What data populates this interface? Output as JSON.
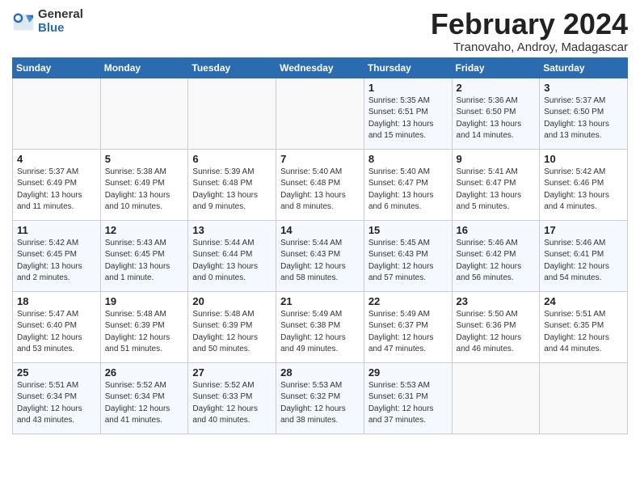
{
  "logo": {
    "general": "General",
    "blue": "Blue"
  },
  "title": "February 2024",
  "location": "Tranovaho, Androy, Madagascar",
  "days_of_week": [
    "Sunday",
    "Monday",
    "Tuesday",
    "Wednesday",
    "Thursday",
    "Friday",
    "Saturday"
  ],
  "weeks": [
    [
      {
        "num": "",
        "info": ""
      },
      {
        "num": "",
        "info": ""
      },
      {
        "num": "",
        "info": ""
      },
      {
        "num": "",
        "info": ""
      },
      {
        "num": "1",
        "info": "Sunrise: 5:35 AM\nSunset: 6:51 PM\nDaylight: 13 hours\nand 15 minutes."
      },
      {
        "num": "2",
        "info": "Sunrise: 5:36 AM\nSunset: 6:50 PM\nDaylight: 13 hours\nand 14 minutes."
      },
      {
        "num": "3",
        "info": "Sunrise: 5:37 AM\nSunset: 6:50 PM\nDaylight: 13 hours\nand 13 minutes."
      }
    ],
    [
      {
        "num": "4",
        "info": "Sunrise: 5:37 AM\nSunset: 6:49 PM\nDaylight: 13 hours\nand 11 minutes."
      },
      {
        "num": "5",
        "info": "Sunrise: 5:38 AM\nSunset: 6:49 PM\nDaylight: 13 hours\nand 10 minutes."
      },
      {
        "num": "6",
        "info": "Sunrise: 5:39 AM\nSunset: 6:48 PM\nDaylight: 13 hours\nand 9 minutes."
      },
      {
        "num": "7",
        "info": "Sunrise: 5:40 AM\nSunset: 6:48 PM\nDaylight: 13 hours\nand 8 minutes."
      },
      {
        "num": "8",
        "info": "Sunrise: 5:40 AM\nSunset: 6:47 PM\nDaylight: 13 hours\nand 6 minutes."
      },
      {
        "num": "9",
        "info": "Sunrise: 5:41 AM\nSunset: 6:47 PM\nDaylight: 13 hours\nand 5 minutes."
      },
      {
        "num": "10",
        "info": "Sunrise: 5:42 AM\nSunset: 6:46 PM\nDaylight: 13 hours\nand 4 minutes."
      }
    ],
    [
      {
        "num": "11",
        "info": "Sunrise: 5:42 AM\nSunset: 6:45 PM\nDaylight: 13 hours\nand 2 minutes."
      },
      {
        "num": "12",
        "info": "Sunrise: 5:43 AM\nSunset: 6:45 PM\nDaylight: 13 hours\nand 1 minute."
      },
      {
        "num": "13",
        "info": "Sunrise: 5:44 AM\nSunset: 6:44 PM\nDaylight: 13 hours\nand 0 minutes."
      },
      {
        "num": "14",
        "info": "Sunrise: 5:44 AM\nSunset: 6:43 PM\nDaylight: 12 hours\nand 58 minutes."
      },
      {
        "num": "15",
        "info": "Sunrise: 5:45 AM\nSunset: 6:43 PM\nDaylight: 12 hours\nand 57 minutes."
      },
      {
        "num": "16",
        "info": "Sunrise: 5:46 AM\nSunset: 6:42 PM\nDaylight: 12 hours\nand 56 minutes."
      },
      {
        "num": "17",
        "info": "Sunrise: 5:46 AM\nSunset: 6:41 PM\nDaylight: 12 hours\nand 54 minutes."
      }
    ],
    [
      {
        "num": "18",
        "info": "Sunrise: 5:47 AM\nSunset: 6:40 PM\nDaylight: 12 hours\nand 53 minutes."
      },
      {
        "num": "19",
        "info": "Sunrise: 5:48 AM\nSunset: 6:39 PM\nDaylight: 12 hours\nand 51 minutes."
      },
      {
        "num": "20",
        "info": "Sunrise: 5:48 AM\nSunset: 6:39 PM\nDaylight: 12 hours\nand 50 minutes."
      },
      {
        "num": "21",
        "info": "Sunrise: 5:49 AM\nSunset: 6:38 PM\nDaylight: 12 hours\nand 49 minutes."
      },
      {
        "num": "22",
        "info": "Sunrise: 5:49 AM\nSunset: 6:37 PM\nDaylight: 12 hours\nand 47 minutes."
      },
      {
        "num": "23",
        "info": "Sunrise: 5:50 AM\nSunset: 6:36 PM\nDaylight: 12 hours\nand 46 minutes."
      },
      {
        "num": "24",
        "info": "Sunrise: 5:51 AM\nSunset: 6:35 PM\nDaylight: 12 hours\nand 44 minutes."
      }
    ],
    [
      {
        "num": "25",
        "info": "Sunrise: 5:51 AM\nSunset: 6:34 PM\nDaylight: 12 hours\nand 43 minutes."
      },
      {
        "num": "26",
        "info": "Sunrise: 5:52 AM\nSunset: 6:34 PM\nDaylight: 12 hours\nand 41 minutes."
      },
      {
        "num": "27",
        "info": "Sunrise: 5:52 AM\nSunset: 6:33 PM\nDaylight: 12 hours\nand 40 minutes."
      },
      {
        "num": "28",
        "info": "Sunrise: 5:53 AM\nSunset: 6:32 PM\nDaylight: 12 hours\nand 38 minutes."
      },
      {
        "num": "29",
        "info": "Sunrise: 5:53 AM\nSunset: 6:31 PM\nDaylight: 12 hours\nand 37 minutes."
      },
      {
        "num": "",
        "info": ""
      },
      {
        "num": "",
        "info": ""
      }
    ]
  ]
}
